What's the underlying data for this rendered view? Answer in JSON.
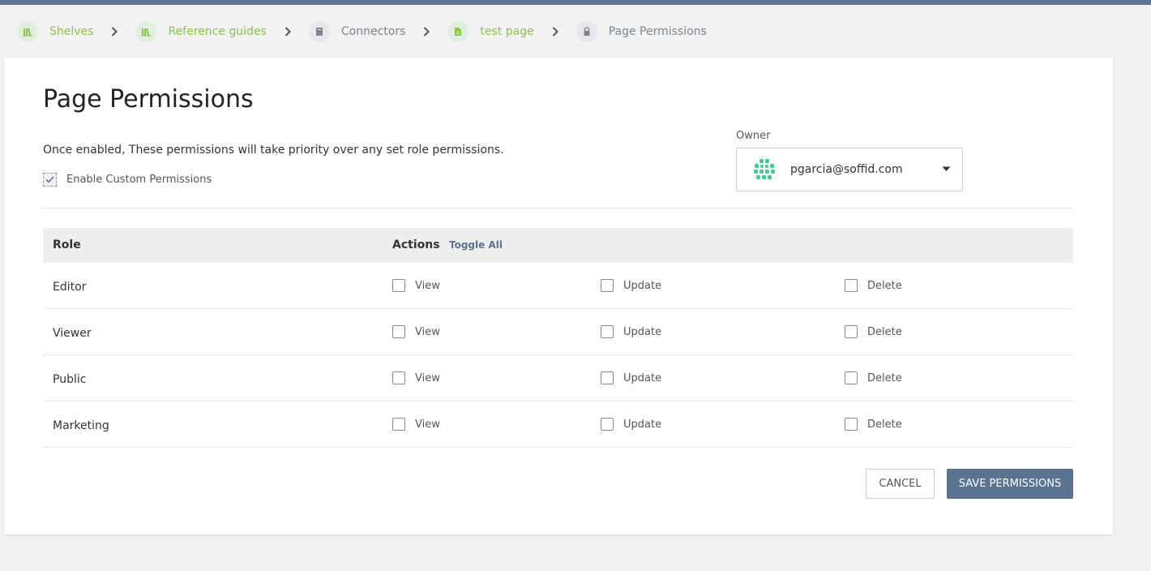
{
  "breadcrumbs": [
    {
      "label": "Shelves",
      "icon": "bookshelf-icon"
    },
    {
      "label": "Reference guides",
      "icon": "bookshelf-icon"
    },
    {
      "label": "Connectors",
      "icon": "book-icon"
    },
    {
      "label": "test page",
      "icon": "page-icon"
    },
    {
      "label": "Page Permissions",
      "icon": "lock-icon"
    }
  ],
  "page": {
    "title": "Page Permissions",
    "description": "Once enabled, These permissions will take priority over any set role permissions.",
    "enable_custom_label": "Enable Custom Permissions",
    "enable_custom_checked": true
  },
  "owner": {
    "label": "Owner",
    "value": "pgarcia@soffid.com"
  },
  "table": {
    "col_role": "Role",
    "col_actions": "Actions",
    "toggle_all": "Toggle All",
    "rows": [
      {
        "role": "Editor",
        "view": "View",
        "update": "Update",
        "delete": "Delete"
      },
      {
        "role": "Viewer",
        "view": "View",
        "update": "Update",
        "delete": "Delete"
      },
      {
        "role": "Public",
        "view": "View",
        "update": "Update",
        "delete": "Delete"
      },
      {
        "role": "Marketing",
        "view": "View",
        "update": "Update",
        "delete": "Delete"
      }
    ]
  },
  "buttons": {
    "cancel": "CANCEL",
    "save": "SAVE PERMISSIONS"
  },
  "colors": {
    "accent": "#5a7390",
    "shelf_green": "#8bc34a",
    "muted": "#7a8590"
  }
}
